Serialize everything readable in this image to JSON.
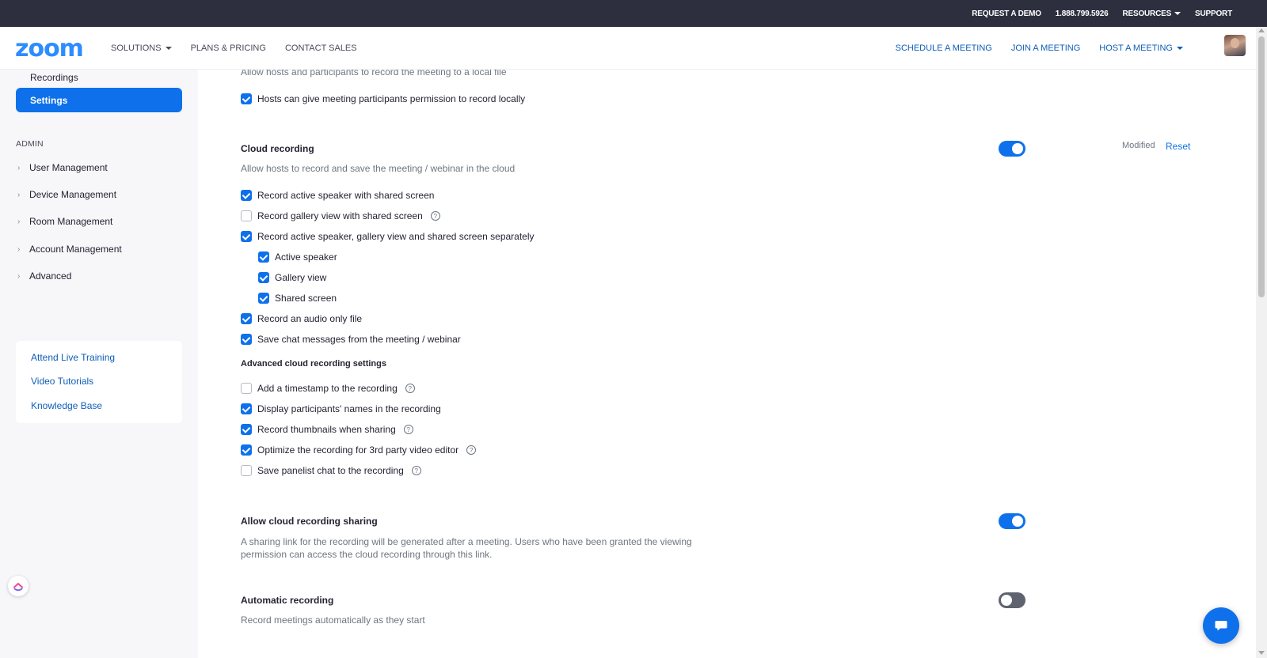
{
  "topbar": {
    "request_demo": "REQUEST A DEMO",
    "phone": "1.888.799.5926",
    "resources": "RESOURCES",
    "support": "SUPPORT"
  },
  "nav": {
    "logo": "zoom",
    "solutions": "SOLUTIONS",
    "plans_pricing": "PLANS & PRICING",
    "contact_sales": "CONTACT SALES",
    "schedule": "SCHEDULE A MEETING",
    "join": "JOIN A MEETING",
    "host": "HOST A MEETING"
  },
  "sidebar": {
    "recordings": "Recordings",
    "settings": "Settings",
    "admin_label": "ADMIN",
    "admin_items": [
      "User Management",
      "Device Management",
      "Room Management",
      "Account Management",
      "Advanced"
    ],
    "help_links": [
      "Attend Live Training",
      "Video Tutorials",
      "Knowledge Base"
    ]
  },
  "local_recording": {
    "description": "Allow hosts and participants to record the meeting to a local file",
    "options": [
      {
        "label": "Hosts can give meeting participants permission to record locally",
        "checked": true
      }
    ]
  },
  "cloud_recording": {
    "title": "Cloud recording",
    "description": "Allow hosts to record and save the meeting / webinar in the cloud",
    "enabled": true,
    "modified": "Modified",
    "reset": "Reset",
    "options": [
      {
        "label": "Record active speaker with shared screen",
        "checked": true,
        "help": false
      },
      {
        "label": "Record gallery view with shared screen",
        "checked": false,
        "help": true
      },
      {
        "label": "Record active speaker, gallery view and shared screen separately",
        "checked": true,
        "help": false
      },
      {
        "label": "Active speaker",
        "checked": true,
        "help": false
      },
      {
        "label": "Gallery view",
        "checked": true,
        "help": false
      },
      {
        "label": "Shared screen",
        "checked": true,
        "help": false
      },
      {
        "label": "Record an audio only file",
        "checked": true,
        "help": false
      },
      {
        "label": "Save chat messages from the meeting / webinar",
        "checked": true,
        "help": false
      }
    ],
    "advanced_title": "Advanced cloud recording settings",
    "advanced_options": [
      {
        "label": "Add a timestamp to the recording",
        "checked": false,
        "help": true
      },
      {
        "label": "Display participants' names in the recording",
        "checked": true,
        "help": false
      },
      {
        "label": "Record thumbnails when sharing",
        "checked": true,
        "help": true
      },
      {
        "label": "Optimize the recording for 3rd party video editor",
        "checked": true,
        "help": true
      },
      {
        "label": "Save panelist chat to the recording",
        "checked": false,
        "help": true
      }
    ]
  },
  "cloud_sharing": {
    "title": "Allow cloud recording sharing",
    "description_line1": "A sharing link for the recording will be generated after a meeting. Users who have been granted the viewing",
    "description_line2": "permission can access the cloud recording through this link.",
    "enabled": true
  },
  "automatic_recording": {
    "title": "Automatic recording",
    "description": "Record meetings automatically as they start",
    "enabled": false
  },
  "icons": {
    "chat": "chat-bubble-icon",
    "help": "question-circle-icon",
    "chevron": "chevron-right-icon",
    "clickup": "clickup-logo-icon"
  },
  "colors": {
    "accent": "#0e71eb",
    "topbar": "#2d2f3f",
    "sidebar": "#f7f7fa",
    "link": "#0e5eb8"
  }
}
